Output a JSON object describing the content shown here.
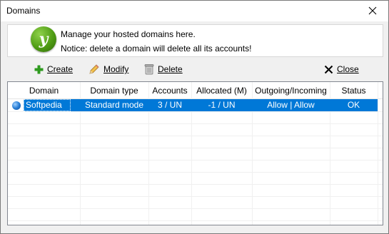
{
  "window": {
    "title": "Domains"
  },
  "info": {
    "line1": "Manage your hosted domains here.",
    "line2": "Notice: delete a domain will delete all its accounts!"
  },
  "toolbar": {
    "create_label": "Create",
    "modify_label": "Modify",
    "delete_label": "Delete",
    "close_label": "Close"
  },
  "table": {
    "columns": [
      "Domain",
      "Domain type",
      "Accounts",
      "Allocated (M)",
      "Outgoing/Incoming",
      "Status"
    ],
    "rows": [
      {
        "domain": "Softpedia",
        "type": "Standard mode",
        "accounts": "3 / UN",
        "allocated": "-1 / UN",
        "traffic": "Allow | Allow",
        "status": "OK",
        "selected": true
      }
    ]
  },
  "colors": {
    "selection": "#0078d7",
    "create_icon": "#2e9a1e",
    "logo": "#4f9c14"
  },
  "icons": {
    "logo": "app-logo-icon",
    "create": "plus-icon",
    "modify": "pencil-icon",
    "delete": "trash-icon",
    "close": "x-icon",
    "row": "globe-icon"
  }
}
